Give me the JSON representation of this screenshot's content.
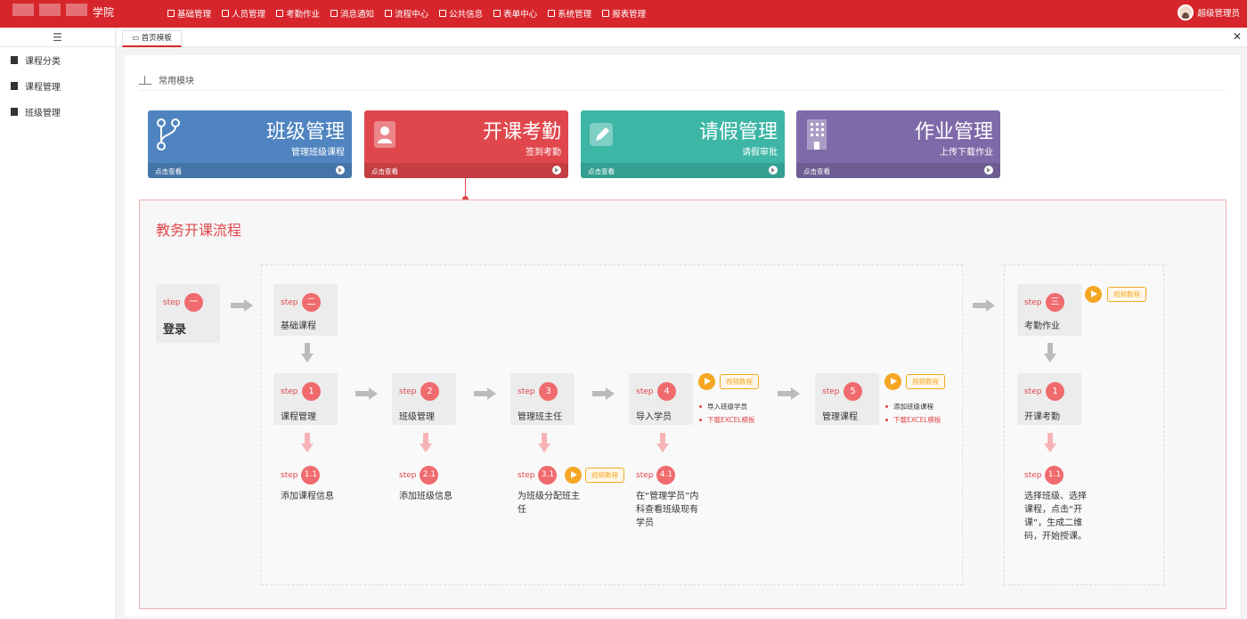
{
  "header": {
    "logo_text": "学院",
    "nav": [
      {
        "label": "基础管理",
        "icon": "grid-icon"
      },
      {
        "label": "人员管理",
        "icon": "id-card-icon"
      },
      {
        "label": "考勤作业",
        "icon": "book-icon"
      },
      {
        "label": "消息通知",
        "icon": "message-icon"
      },
      {
        "label": "流程中心",
        "icon": "share-icon"
      },
      {
        "label": "公共信息",
        "icon": "globe-icon"
      },
      {
        "label": "表单中心",
        "icon": "table-icon"
      },
      {
        "label": "系统管理",
        "icon": "monitor-icon"
      },
      {
        "label": "报表管理",
        "icon": "report-icon"
      }
    ],
    "user_name": "超级管理员"
  },
  "sidebar": {
    "items": [
      {
        "label": "课程分类",
        "icon": "bookmark-icon"
      },
      {
        "label": "课程管理",
        "icon": "book-icon"
      },
      {
        "label": "班级管理",
        "icon": "flag-icon"
      }
    ]
  },
  "tabs": {
    "active": "首页模板",
    "close_all": "✕"
  },
  "section": {
    "title": "常用模块"
  },
  "cards": [
    {
      "title": "班级管理",
      "subtitle": "管理班级课程",
      "footer": "点击查看",
      "color": "#4f84c0",
      "icon": "fork-icon"
    },
    {
      "title": "开课考勤",
      "subtitle": "签到考勤",
      "footer": "点击查看",
      "color": "#e0474c",
      "icon": "contact-book-icon"
    },
    {
      "title": "请假管理",
      "subtitle": "请假审批",
      "footer": "点击查看",
      "color": "#3db6a5",
      "icon": "edit-icon"
    },
    {
      "title": "作业管理",
      "subtitle": "上传下载作业",
      "footer": "点击查看",
      "color": "#7e6aa8",
      "icon": "building-icon"
    }
  ],
  "process": {
    "title": "教务开课流程",
    "step_word": "step",
    "tutorial_label": "视频教程",
    "login": {
      "num": "一",
      "name": "登录"
    },
    "basic": {
      "num": "二",
      "name": "基础课程"
    },
    "steps": [
      {
        "num": "1",
        "name": "课程管理",
        "sub_num": "1.1",
        "sub_desc": "添加课程信息"
      },
      {
        "num": "2",
        "name": "班级管理",
        "sub_num": "2.1",
        "sub_desc": "添加班级信息"
      },
      {
        "num": "3",
        "name": "管理班主任",
        "sub_num": "3.1",
        "sub_desc": "为班级分配班主任"
      },
      {
        "num": "4",
        "name": "导入学员",
        "sub_num": "4.1",
        "sub_desc": "在“管理学员”内科查看班级现有学员",
        "bullets": [
          "导入班级学员",
          "下载EXCEL模板"
        ]
      },
      {
        "num": "5",
        "name": "管理课程",
        "bullets": [
          "添加班级课程",
          "下载EXCEL模板"
        ]
      }
    ],
    "right": {
      "num": "三",
      "name": "考勤作业",
      "step": {
        "num": "1",
        "name": "开课考勤",
        "sub_num": "1.1",
        "sub_desc": "选择班级、选择课程，点击“开课”，生成二维码，开始授课。"
      }
    }
  }
}
